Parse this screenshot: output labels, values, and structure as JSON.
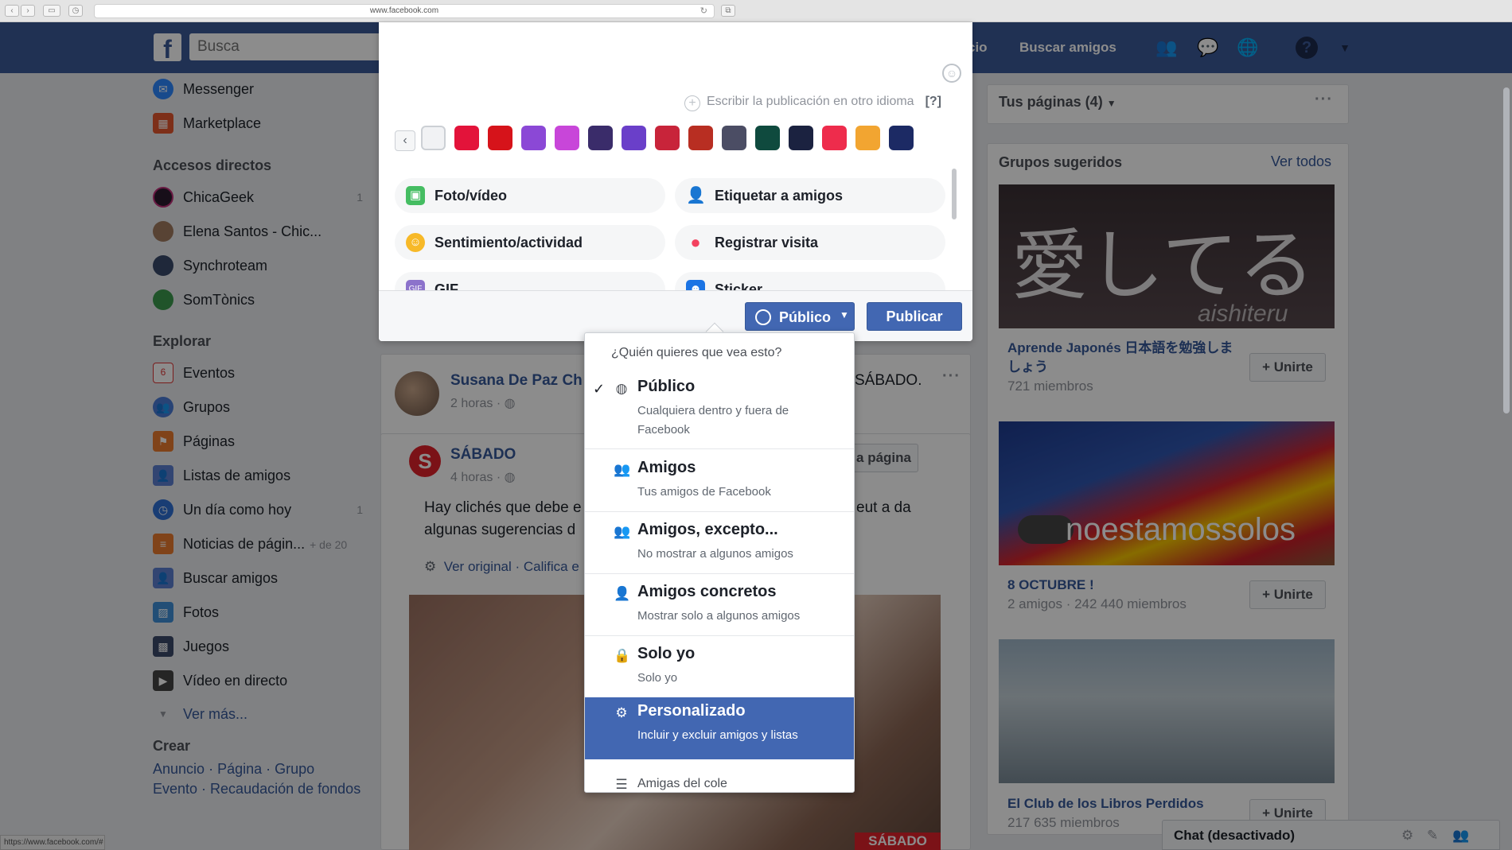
{
  "browser": {
    "url": "www.facebook.com",
    "status_url": "https://www.facebook.com/#"
  },
  "topbar": {
    "logo": "f",
    "search_placeholder": "Busca",
    "link_partial": "cio",
    "find_friends": "Buscar amigos"
  },
  "sidebar": {
    "items_top": [
      {
        "label": "Messenger",
        "icon": "messenger-icon"
      },
      {
        "label": "Marketplace",
        "icon": "marketplace-icon"
      }
    ],
    "shortcuts_heading": "Accesos directos",
    "shortcuts": [
      {
        "label": "ChicaGeek",
        "count": "1"
      },
      {
        "label": "Elena Santos - Chic...",
        "count": ""
      },
      {
        "label": "Synchroteam",
        "count": ""
      },
      {
        "label": "SomTònics",
        "count": ""
      }
    ],
    "explore_heading": "Explorar",
    "explore": [
      {
        "label": "Eventos",
        "count": "",
        "extra": "",
        "badge": "6"
      },
      {
        "label": "Grupos",
        "count": "",
        "extra": ""
      },
      {
        "label": "Páginas",
        "count": "",
        "extra": ""
      },
      {
        "label": "Listas de amigos",
        "count": "",
        "extra": ""
      },
      {
        "label": "Un día como hoy",
        "count": "1",
        "extra": ""
      },
      {
        "label": "Noticias de págin...",
        "count": "",
        "extra": "+ de 20"
      },
      {
        "label": "Buscar amigos",
        "count": "",
        "extra": ""
      },
      {
        "label": "Fotos",
        "count": "",
        "extra": ""
      },
      {
        "label": "Juegos",
        "count": "",
        "extra": ""
      },
      {
        "label": "Vídeo en directo",
        "count": "",
        "extra": ""
      }
    ],
    "see_more": "Ver más...",
    "create_heading": "Crear",
    "create_links_1": [
      "Anuncio",
      "Página",
      "Grupo"
    ],
    "create_links_2": [
      "Evento",
      "Recaudación de fondos"
    ],
    "separator": " · "
  },
  "composer": {
    "other_language": "Escribir la publicación en otro idioma",
    "help": "[?]",
    "swatch_colors": [
      "#f1f2f4",
      "#e3133a",
      "#d6131a",
      "#8b48d6",
      "#c846d9",
      "#3a2c6a",
      "#6a3fc9",
      "#c8243a",
      "#b82e22",
      "#4b4d64",
      "#0f4a3e",
      "#1b2240",
      "#ee2c4c",
      "#f2a531",
      "#1c2a64"
    ],
    "actions": [
      {
        "label": "Foto/vídeo",
        "icon": "photo-icon",
        "color": "#45bd62"
      },
      {
        "label": "Etiquetar a amigos",
        "icon": "tag-friends-icon",
        "color": "#1877f2"
      },
      {
        "label": "Sentimiento/actividad",
        "icon": "feeling-icon",
        "color": "#f7b928"
      },
      {
        "label": "Registrar visita",
        "icon": "location-pin-icon",
        "color": "#f3425f"
      },
      {
        "label": "GIF",
        "icon": "gif-icon",
        "color": "#8c72cb"
      },
      {
        "label": "Sticker",
        "icon": "sticker-icon",
        "color": "#1b74e4"
      }
    ],
    "audience_button": "Público",
    "publish_button": "Publicar"
  },
  "audience_menu": {
    "heading": "¿Quién quieres que vea esto?",
    "options": [
      {
        "title": "Público",
        "desc": "Cualquiera dentro y fuera de Facebook",
        "icon": "globe-icon",
        "checked": true
      },
      {
        "title": "Amigos",
        "desc": "Tus amigos de Facebook",
        "icon": "friends-icon"
      },
      {
        "title": "Amigos, excepto...",
        "desc": "No mostrar a algunos amigos",
        "icon": "friends-except-icon"
      },
      {
        "title": "Amigos concretos",
        "desc": "Mostrar solo a algunos amigos",
        "icon": "person-icon"
      },
      {
        "title": "Solo yo",
        "desc": "Solo yo",
        "icon": "lock-icon"
      },
      {
        "title": "Personalizado",
        "desc": "Incluir y excluir amigos y listas",
        "icon": "gear-icon",
        "selected": true
      }
    ],
    "partial_item": "Amigas del cole"
  },
  "feed": {
    "post1": {
      "name": "Susana De Paz Ch",
      "time": "2 horas · ",
      "tail": "SÁBADO."
    },
    "post2": {
      "name": "SÁBADO",
      "time": "4 horas · ",
      "page_button": "a página",
      "text_line1": "Hay clichés que debe e",
      "text_line1_tail": "eut a da",
      "text_line2": "algunas sugerencias d",
      "see_original": "Ver original",
      "rate": "Califica e",
      "image_caption": "SÁBADO"
    }
  },
  "right": {
    "pages_heading": "Tus páginas (4)",
    "groups_heading": "Grupos sugeridos",
    "see_all": "Ver todos",
    "join": "+ Unirte",
    "groups": [
      {
        "title": "Aprende Japonés 日本語を勉強しましょう",
        "meta": "721 miembros",
        "img_text": "愛してる",
        "img_sub": "aishiteru"
      },
      {
        "title": "8 OCTUBRE !",
        "meta": "2 amigos · 242 440 miembros",
        "img_text": "noestamossolos"
      },
      {
        "title": "El Club de los Libros Perdidos",
        "meta": "217 635 miembros"
      }
    ]
  },
  "chat": {
    "label": "Chat (desactivado)"
  }
}
